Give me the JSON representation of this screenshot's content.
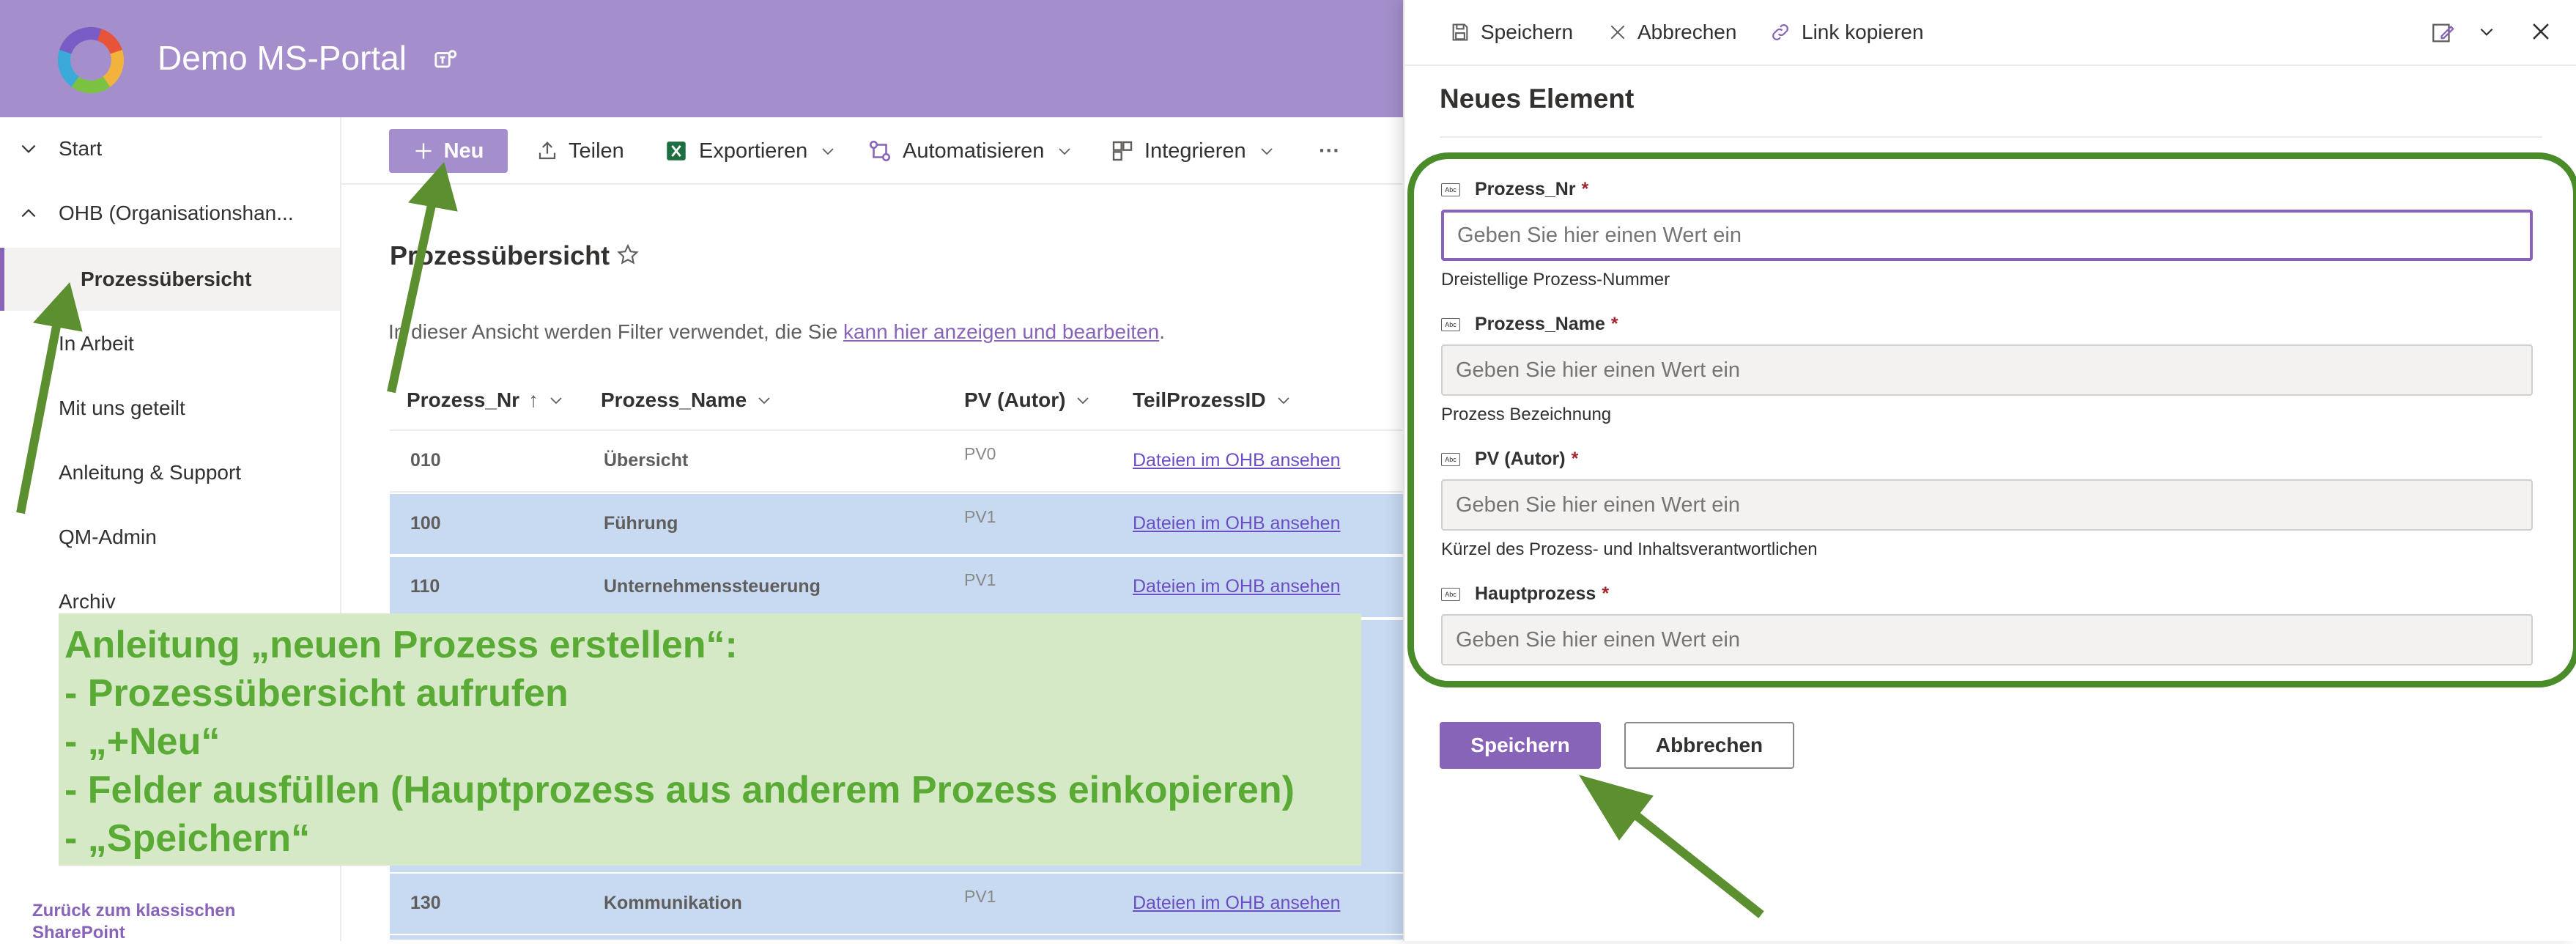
{
  "site": {
    "title": "Demo MS-Portal"
  },
  "nav": {
    "items": [
      {
        "label": "Start"
      },
      {
        "label": "OHB (Organisationshan..."
      },
      {
        "label": "Prozessübersicht"
      },
      {
        "label": "In Arbeit"
      },
      {
        "label": "Mit uns geteilt"
      },
      {
        "label": "Anleitung & Support"
      },
      {
        "label": "QM-Admin"
      },
      {
        "label": "Archiv"
      }
    ],
    "back_link": "Zurück zum klassischen SharePoint"
  },
  "commandbar": {
    "new": "Neu",
    "share": "Teilen",
    "export": "Exportieren",
    "automate": "Automatisieren",
    "integrate": "Integrieren",
    "more": "···"
  },
  "list": {
    "title": "Prozessübersicht",
    "filter_prefix": "In dieser Ansicht werden Filter verwendet, die Sie ",
    "filter_link": "kann hier anzeigen und bearbeiten",
    "filter_suffix": ".",
    "columns": [
      "Prozess_Nr",
      "Prozess_Name",
      "PV (Autor)",
      "TeilProzessID"
    ],
    "sort_indicator": "↑",
    "rows": [
      {
        "nr": "010",
        "name": "Übersicht",
        "pv": "PV0",
        "link": "Dateien im OHB ansehen"
      },
      {
        "nr": "100",
        "name": "Führung",
        "pv": "PV1",
        "link": "Dateien im OHB ansehen"
      },
      {
        "nr": "110",
        "name": "Unternehmenssteuerung",
        "pv": "PV1",
        "link": "Dateien im OHB ansehen"
      },
      {
        "nr": "130",
        "name": "Kommunikation",
        "pv": "PV1",
        "link": "Dateien im OHB ansehen"
      }
    ]
  },
  "annotation": {
    "lines": [
      "Anleitung „neuen Prozess erstellen“:",
      "- Prozessübersicht aufrufen",
      "- „+Neu“",
      "- Felder ausfüllen (Hauptprozess aus anderem Prozess einkopieren)",
      "- „Speichern“"
    ]
  },
  "panel": {
    "save": "Speichern",
    "cancel": "Abbrechen",
    "copy_link": "Link kopieren",
    "title": "Neues Element",
    "field_type_badge": "Abc",
    "required_mark": "*",
    "fields": [
      {
        "label": "Prozess_Nr",
        "placeholder": "Geben Sie hier einen Wert ein",
        "desc": "Dreistellige Prozess-Nummer"
      },
      {
        "label": "Prozess_Name",
        "placeholder": "Geben Sie hier einen Wert ein",
        "desc": "Prozess Bezeichnung"
      },
      {
        "label": "PV (Autor)",
        "placeholder": "Geben Sie hier einen Wert ein",
        "desc": "Kürzel des Prozess- und Inhaltsverantwortlichen"
      },
      {
        "label": "Hauptprozess",
        "placeholder": "Geben Sie hier einen Wert ein",
        "desc": ""
      }
    ],
    "form_save": "Speichern",
    "form_cancel": "Abbrechen"
  },
  "colors": {
    "header": "#a48fcc",
    "accent": "#8764b8",
    "selected_row": "#c7daf2",
    "annotation_bg": "#d6e9c6",
    "annotation_text": "#5aab36",
    "arrow": "#5b8f2f"
  }
}
